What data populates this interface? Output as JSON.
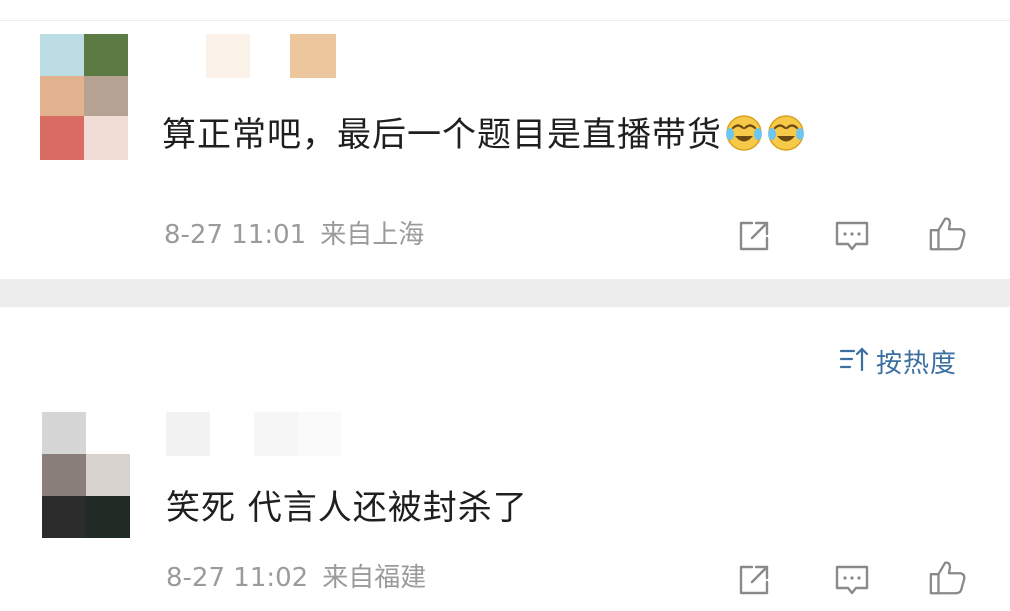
{
  "comments": [
    {
      "text": "算正常吧，最后一个题目是直播带货",
      "emojis": [
        "laughing-crying-emoji",
        "laughing-crying-emoji"
      ],
      "time": "8-27 11:01",
      "location": "来自上海"
    },
    {
      "text": "笑死 代言人还被封杀了",
      "time": "8-27 11:02",
      "location": "来自福建"
    }
  ],
  "sort": {
    "label": "按热度",
    "icon": "sort-icon"
  },
  "icons": {
    "share": "share-icon",
    "reply": "comment-icon",
    "like": "thumbs-up-icon"
  },
  "colors": {
    "text": "#1f1f1f",
    "meta": "#9b9b9b",
    "link": "#3c6fa0",
    "divider": "#ededed"
  }
}
